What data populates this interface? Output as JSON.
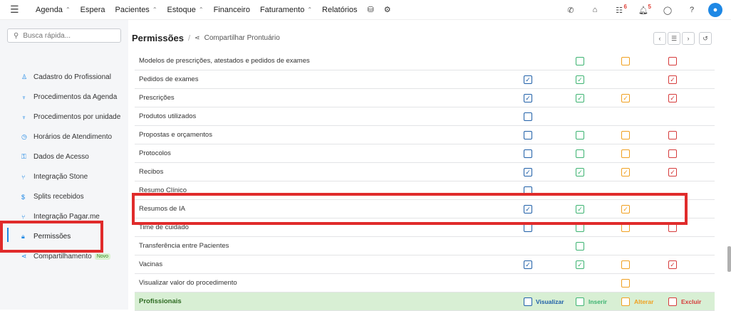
{
  "nav": {
    "items": [
      {
        "label": "Agenda",
        "dropdown": true
      },
      {
        "label": "Espera",
        "dropdown": false
      },
      {
        "label": "Pacientes",
        "dropdown": true
      },
      {
        "label": "Estoque",
        "dropdown": true
      },
      {
        "label": "Financeiro",
        "dropdown": false
      },
      {
        "label": "Faturamento",
        "dropdown": true
      },
      {
        "label": "Relatórios",
        "dropdown": false
      }
    ],
    "badges": {
      "tasks": "6",
      "notifications": "5"
    }
  },
  "search": {
    "placeholder": "Busca rápida..."
  },
  "sidebar": {
    "items": [
      {
        "label": "Cadastro do Profissional",
        "icon": "user-icon"
      },
      {
        "label": "Procedimentos da Agenda",
        "icon": "stethoscope-icon"
      },
      {
        "label": "Procedimentos por unidade",
        "icon": "stethoscope-icon"
      },
      {
        "label": "Horários de Atendimento",
        "icon": "clock-icon"
      },
      {
        "label": "Dados de Acesso",
        "icon": "key-icon"
      },
      {
        "label": "Integração Stone",
        "icon": "branch-icon"
      },
      {
        "label": "Splits recebidos",
        "icon": "dollar-icon"
      },
      {
        "label": "Integração Pagar.me",
        "icon": "branch-icon"
      },
      {
        "label": "Permissões",
        "icon": "lock-icon"
      },
      {
        "label": "Compartilhamento",
        "icon": "share-icon",
        "badge": "Novo"
      }
    ]
  },
  "header": {
    "title": "Permissões",
    "breadcrumb": "Compartilhar Prontuário"
  },
  "permissions": {
    "rows": [
      {
        "label": "Modelos de prescrições, atestados e pedidos de exames",
        "v": null,
        "i": false,
        "a": false,
        "e": false
      },
      {
        "label": "Pedidos de exames",
        "v": true,
        "i": true,
        "a": null,
        "e": true
      },
      {
        "label": "Prescrições",
        "v": true,
        "i": true,
        "a": true,
        "e": true
      },
      {
        "label": "Produtos utilizados",
        "v": false,
        "i": null,
        "a": null,
        "e": null
      },
      {
        "label": "Propostas e orçamentos",
        "v": false,
        "i": false,
        "a": false,
        "e": false
      },
      {
        "label": "Protocolos",
        "v": false,
        "i": false,
        "a": false,
        "e": false
      },
      {
        "label": "Recibos",
        "v": true,
        "i": true,
        "a": true,
        "e": true
      },
      {
        "label": "Resumo Clínico",
        "v": false,
        "i": null,
        "a": null,
        "e": null
      },
      {
        "label": "Resumos de IA",
        "v": true,
        "i": true,
        "a": true,
        "e": null
      },
      {
        "label": "Time de cuidado",
        "v": false,
        "i": false,
        "a": false,
        "e": false
      },
      {
        "label": "Transferência entre Pacientes",
        "v": null,
        "i": false,
        "a": null,
        "e": null
      },
      {
        "label": "Vacinas",
        "v": true,
        "i": true,
        "a": false,
        "e": true
      },
      {
        "label": "Visualizar valor do procedimento",
        "v": null,
        "i": null,
        "a": false,
        "e": null
      }
    ],
    "group": {
      "label": "Profissionais"
    },
    "legend": {
      "view": "Visualizar",
      "insert": "Inserir",
      "edit": "Alterar",
      "delete": "Excluir"
    }
  },
  "colors": {
    "accent": "#1e88e5",
    "view": "#1f5fa8",
    "insert": "#3cb371",
    "edit": "#f0a020",
    "delete": "#d63b3b",
    "highlight": "#e02b2b"
  }
}
